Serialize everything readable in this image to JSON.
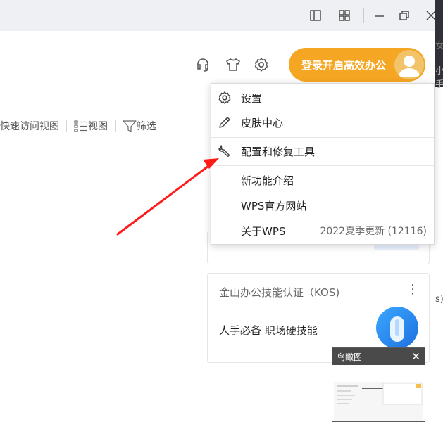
{
  "window": {
    "controls": [
      "tablet-mode-icon",
      "grid-icon",
      "minimize-icon",
      "restore-icon",
      "close-icon"
    ]
  },
  "strip": {
    "text_top": "女",
    "text_mid": "小手",
    "text_bottom": "s)"
  },
  "header": {
    "icons": [
      "headset-icon",
      "tshirt-icon",
      "gear-icon"
    ],
    "login_label": "登录开启高效办公"
  },
  "view_bar": {
    "quick_access": "快速访问视图",
    "view": "视图",
    "filter": "筛选"
  },
  "menu": {
    "items": [
      {
        "label": "设置",
        "icon": "gear-icon"
      },
      {
        "label": "皮肤中心",
        "icon": "pen-icon"
      },
      {
        "label": "配置和修复工具",
        "icon": "wrench-icon"
      },
      {
        "label": "新功能介绍"
      },
      {
        "label": "WPS官方网站"
      },
      {
        "label": "关于WPS",
        "version": "2022夏季更新 (12116)"
      }
    ]
  },
  "kos_card": {
    "title": "金山办公技能认证（KOS)",
    "subtitle": "人手必备 职场硬技能",
    "more": "⋮"
  },
  "bird_view": {
    "title": "鸟瞰图",
    "close": "✕"
  },
  "colors": {
    "accent": "#f5a623",
    "arrow": "#ff1a1a"
  }
}
